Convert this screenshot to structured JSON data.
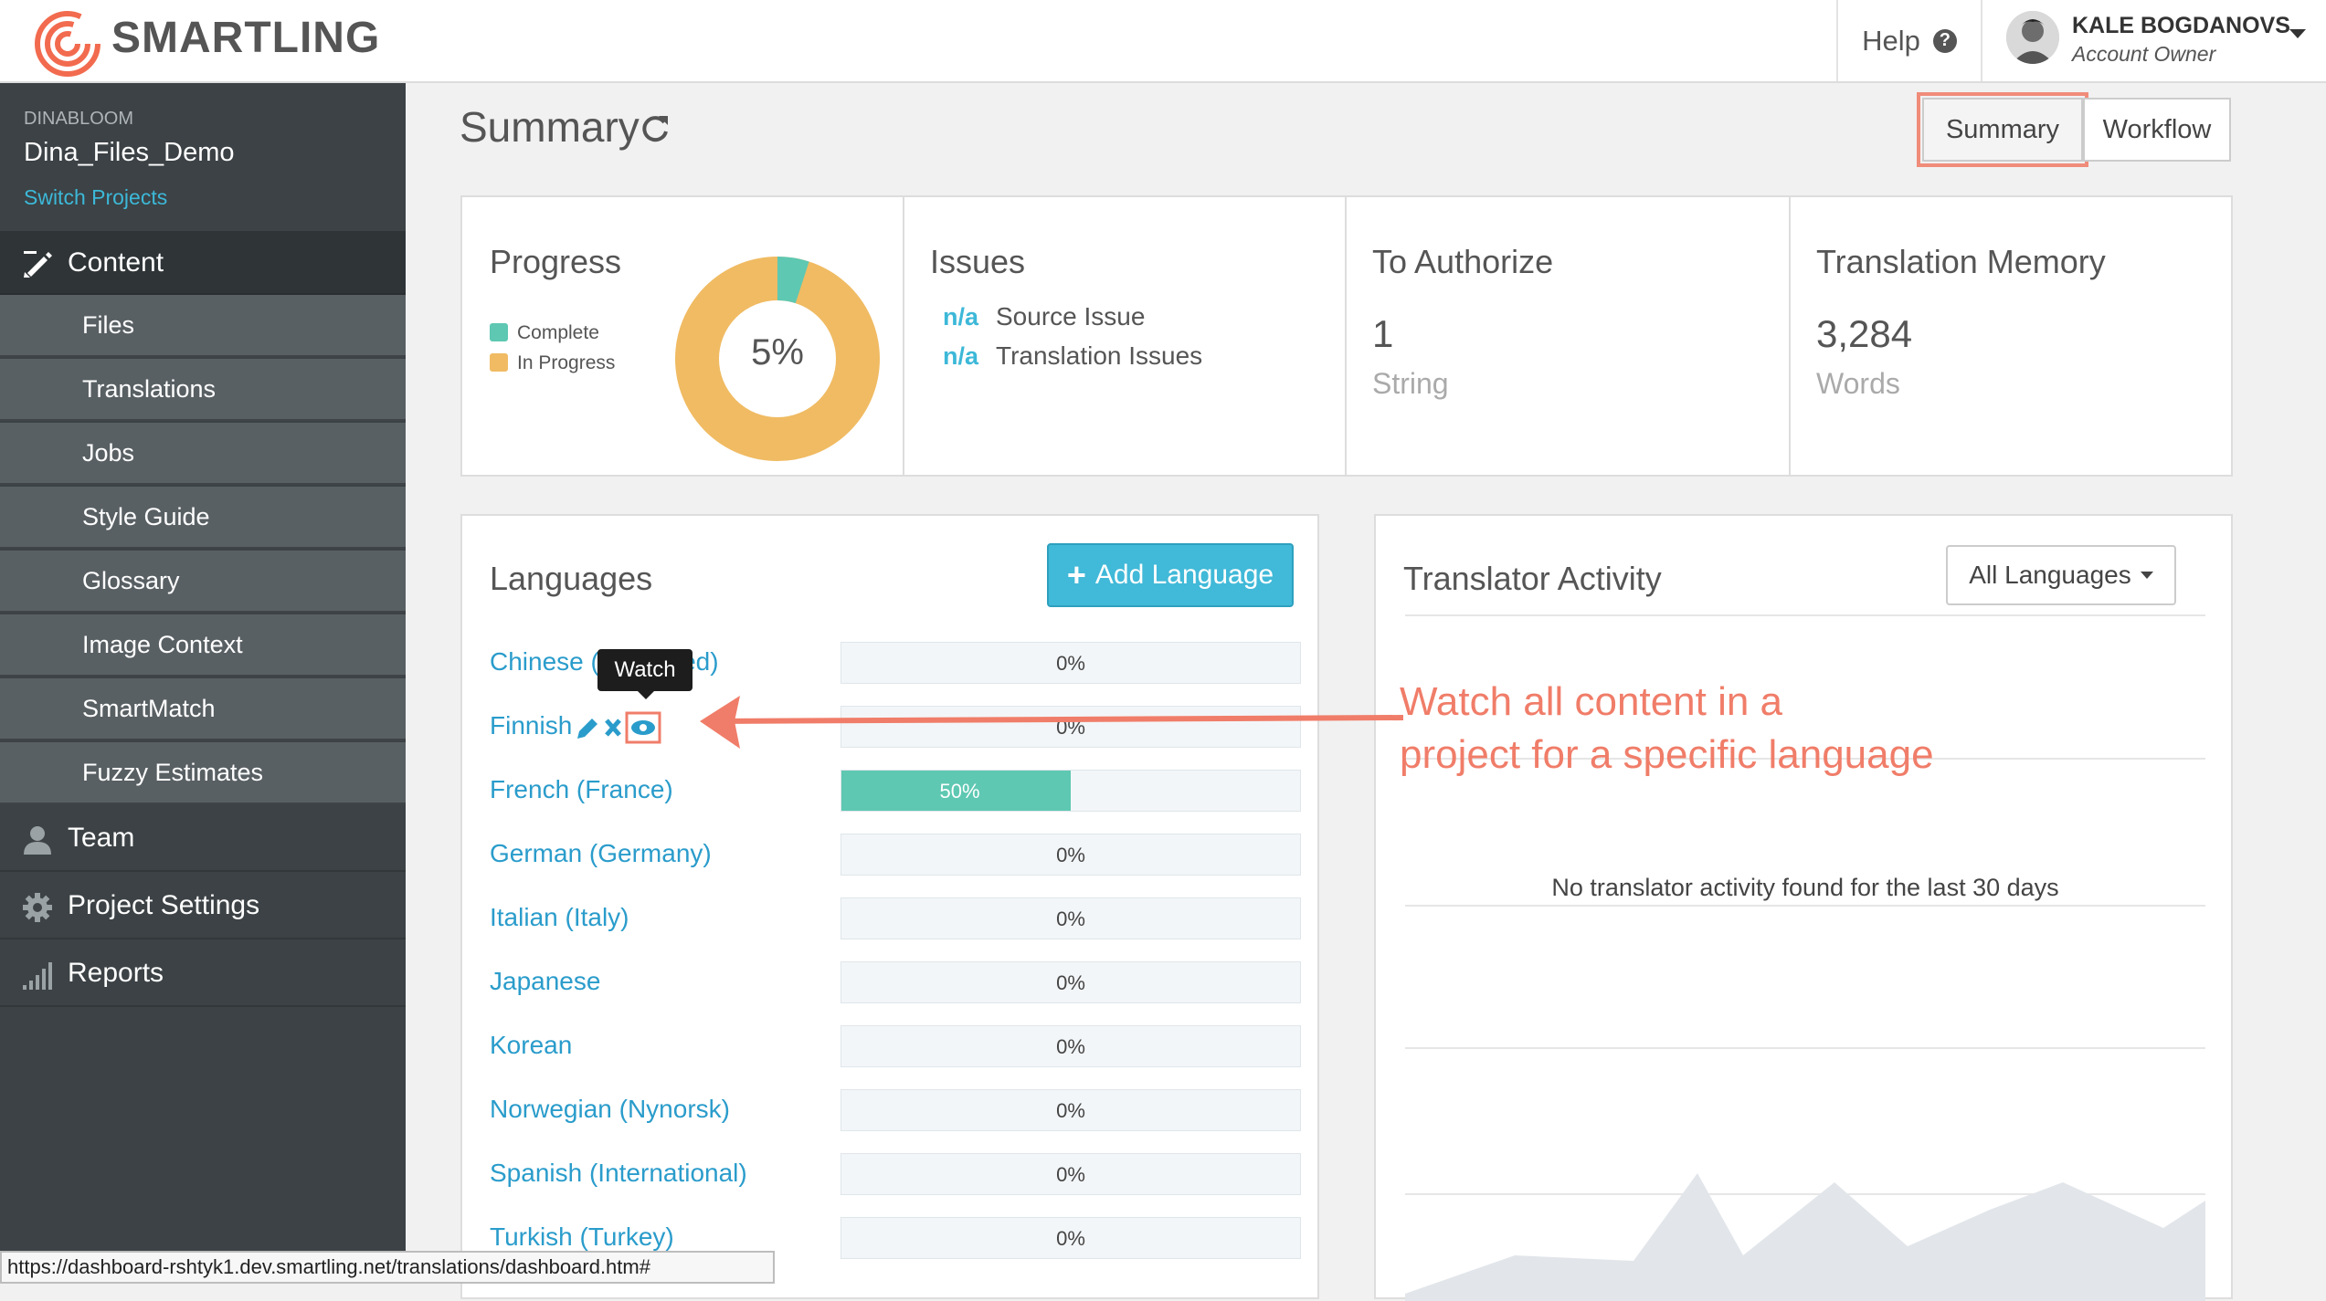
{
  "brand": {
    "name": "SMARTLING"
  },
  "header": {
    "help_label": "Help",
    "help_glyph": "?",
    "user": {
      "name": "KALE BOGDANOVS",
      "role": "Account Owner"
    }
  },
  "sidebar": {
    "project_org": "DINABLOOM",
    "project_name": "Dina_Files_Demo",
    "switch_label": "Switch Projects",
    "content_label": "Content",
    "content_items": [
      {
        "label": "Files"
      },
      {
        "label": "Translations"
      },
      {
        "label": "Jobs"
      },
      {
        "label": "Style Guide"
      },
      {
        "label": "Glossary"
      },
      {
        "label": "Image Context"
      },
      {
        "label": "SmartMatch"
      },
      {
        "label": "Fuzzy Estimates"
      }
    ],
    "sections": [
      {
        "label": "Team",
        "icon": "person-icon"
      },
      {
        "label": "Project Settings",
        "icon": "gear-icon"
      },
      {
        "label": "Reports",
        "icon": "signal-bars-icon"
      }
    ]
  },
  "main": {
    "title": "Summary",
    "view_buttons": {
      "summary": "Summary",
      "workflow": "Workflow"
    },
    "progress": {
      "title": "Progress",
      "legend": [
        {
          "label": "Complete",
          "color": "#5ec8b2"
        },
        {
          "label": "In Progress",
          "color": "#f0bb63"
        }
      ],
      "percent": 5,
      "percent_label": "5%"
    },
    "issues": {
      "title": "Issues",
      "items": [
        {
          "count": "n/a",
          "label": "Source Issue"
        },
        {
          "count": "n/a",
          "label": "Translation Issues"
        }
      ]
    },
    "to_authorize": {
      "title": "To Authorize",
      "value": "1",
      "unit": "String"
    },
    "translation_memory": {
      "title": "Translation Memory",
      "value": "3,284",
      "unit": "Words"
    },
    "languages": {
      "title": "Languages",
      "add_label": "Add Language",
      "tooltip": "Watch",
      "rows": [
        {
          "name": "Chinese (Simplified)",
          "percent": 0,
          "label": "0%"
        },
        {
          "name": "Finnish",
          "percent": 0,
          "label": "0%"
        },
        {
          "name": "French (France)",
          "percent": 50,
          "label": "50%"
        },
        {
          "name": "German (Germany)",
          "percent": 0,
          "label": "0%"
        },
        {
          "name": "Italian (Italy)",
          "percent": 0,
          "label": "0%"
        },
        {
          "name": "Japanese",
          "percent": 0,
          "label": "0%"
        },
        {
          "name": "Korean",
          "percent": 0,
          "label": "0%"
        },
        {
          "name": "Norwegian (Nynorsk)",
          "percent": 0,
          "label": "0%"
        },
        {
          "name": "Spanish (International)",
          "percent": 0,
          "label": "0%"
        },
        {
          "name": "Turkish (Turkey)",
          "percent": 0,
          "label": "0%"
        }
      ]
    },
    "translator_activity": {
      "title": "Translator Activity",
      "filter_label": "All Languages",
      "empty_message": "No translator activity found for the last 30 days"
    }
  },
  "annotation": {
    "line1": "Watch all content in a",
    "line2": "project for a specific language",
    "color": "#f07d69"
  },
  "status_bar": {
    "url": "https://dashboard-rshtyk1.dev.smartling.net/translations/dashboard.htm#"
  }
}
